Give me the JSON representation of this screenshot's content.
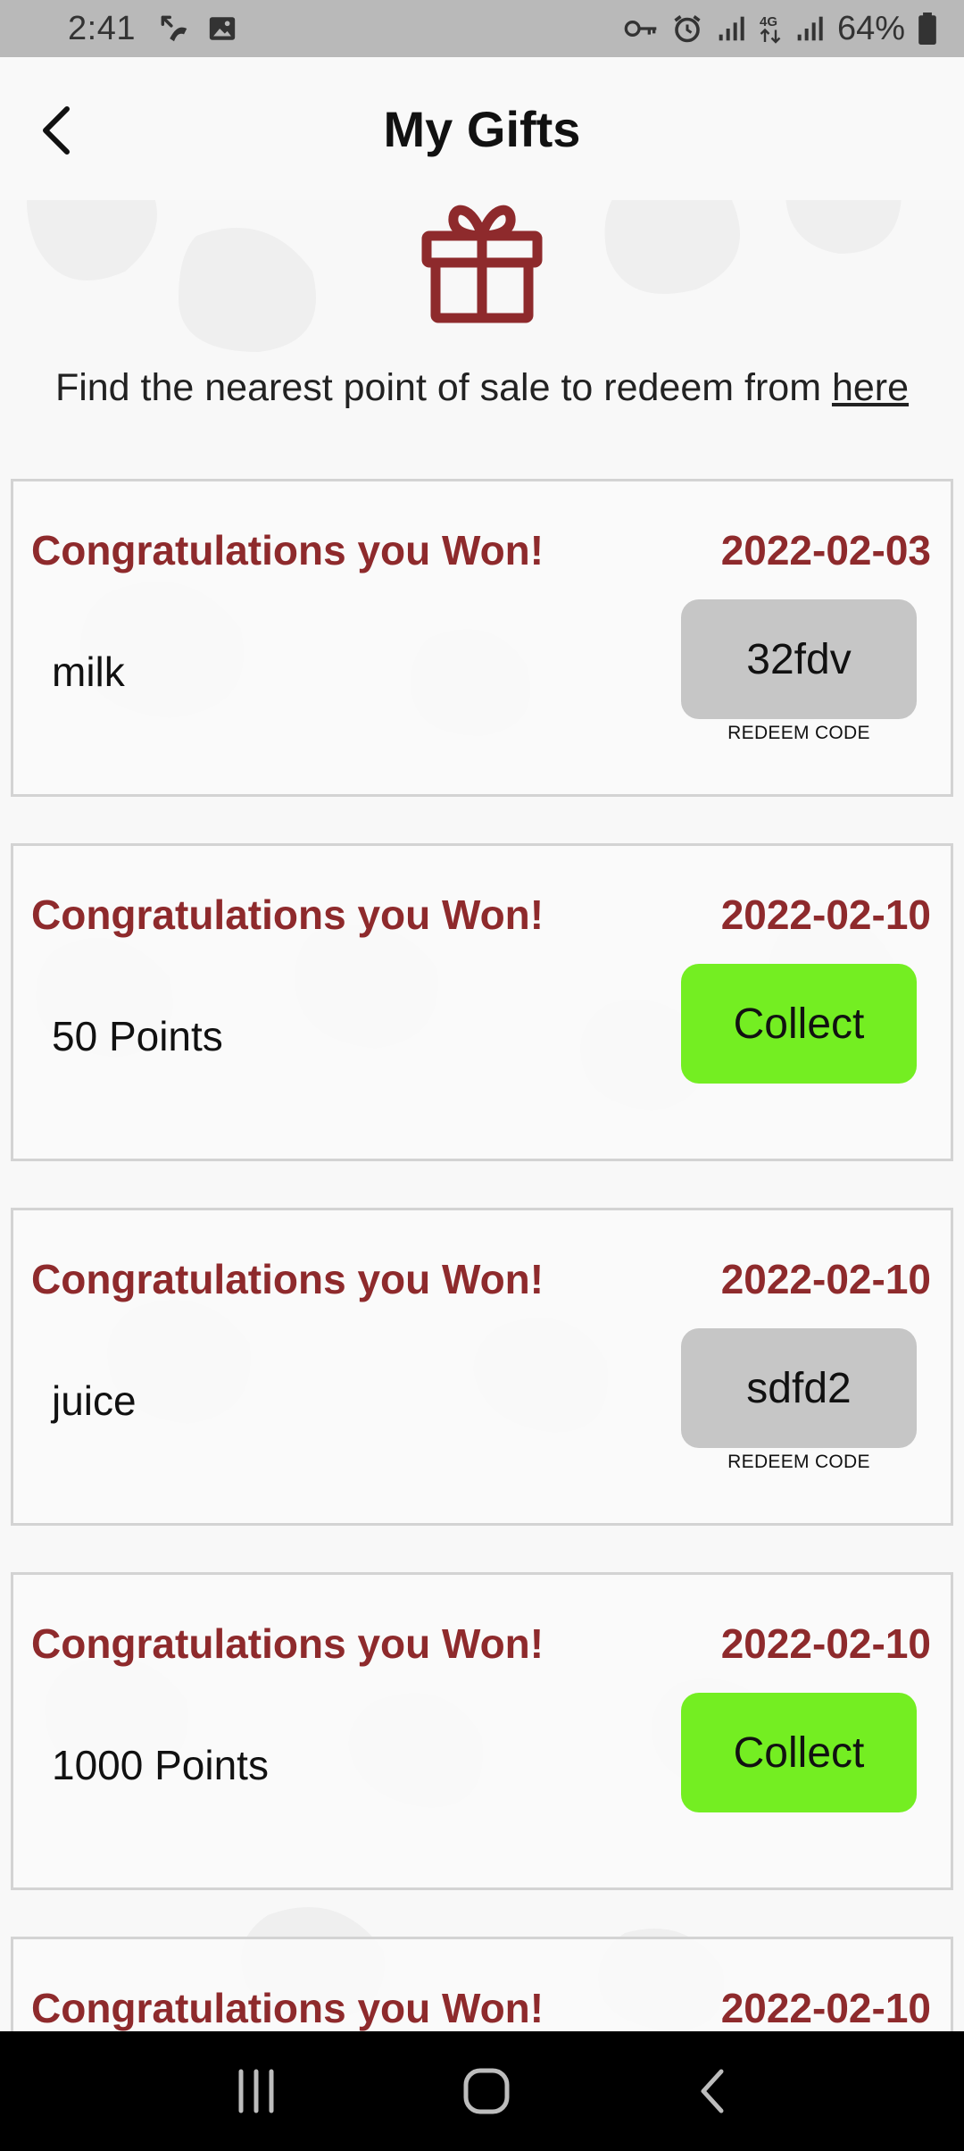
{
  "status_bar": {
    "time": "2:41",
    "battery": "64%",
    "icons": [
      "missed-call-icon",
      "image-icon",
      "key-icon",
      "alarm-icon",
      "signal-icon",
      "4g-icon",
      "signal-icon",
      "battery-icon"
    ]
  },
  "header": {
    "title": "My Gifts",
    "back_icon": "chevron-left-icon"
  },
  "gift_icon": "gift-icon",
  "info": {
    "text": "Find the nearest point of sale to redeem from ",
    "link": "here"
  },
  "colors": {
    "accent": "#8e2a2c",
    "collect": "#74ee22",
    "code": "#c6c6c6"
  },
  "gifts": [
    {
      "title": "Congratulations you Won!",
      "date": "2022-02-03",
      "prize": "milk",
      "action": "32fdv",
      "action_type": "code",
      "code_label": "REDEEM CODE"
    },
    {
      "title": "Congratulations you Won!",
      "date": "2022-02-10",
      "prize": "50 Points",
      "action": "Collect",
      "action_type": "collect"
    },
    {
      "title": "Congratulations you Won!",
      "date": "2022-02-10",
      "prize": "juice",
      "action": "sdfd2",
      "action_type": "code",
      "code_label": "REDEEM CODE"
    },
    {
      "title": "Congratulations you Won!",
      "date": "2022-02-10",
      "prize": "1000 Points",
      "action": "Collect",
      "action_type": "collect"
    },
    {
      "title": "Congratulations you Won!",
      "date": "2022-02-10"
    }
  ],
  "nav": [
    "recents-icon",
    "home-icon",
    "back-icon"
  ]
}
